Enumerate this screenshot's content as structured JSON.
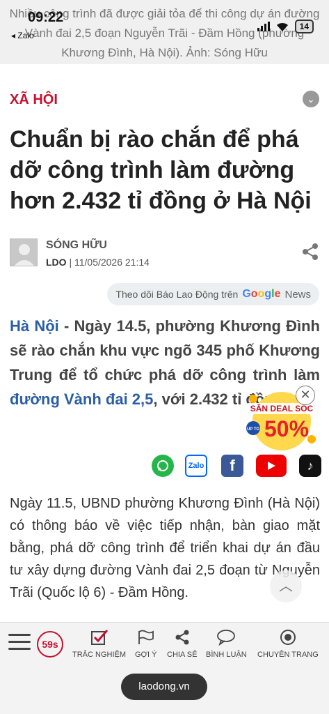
{
  "status_bar": {
    "time": "09:22",
    "back_app": "◂ Zalo",
    "battery": "14"
  },
  "image_caption": "Nhiều công trình đã được giải tỏa để thi công dự án đường Vành đai 2,5 đoạn Nguyễn Trãi - Đầm Hồng (phường Khương Đình, Hà Nội). Ảnh: Sóng Hữu",
  "article": {
    "section": "XÃ HỘI",
    "title": "Chuẩn bị rào chắn để phá dỡ công trình làm đường hơn 2.432 tỉ đồng ở Hà Nội",
    "author": "SÓNG HỮU",
    "source": "LDO",
    "datetime": "| 11/05/2026 21:14",
    "follow": {
      "label": "Theo dõi Báo Lao Động trên",
      "google": "Google",
      "news": "News"
    },
    "lead": {
      "place": "Hà Nội",
      "text1": " - Ngày 14.5, phường Khương Đình sẽ rào chắn khu vực ngõ 345 phố Khương Trung để tổ chức phá dỡ công trình làm ",
      "link": "đường Vành đai 2,5",
      "text2": ", với 2.432 tỉ đồng."
    },
    "body": "Ngày 11.5, UBND phường Khương Đình (Hà Nội) có thông báo về việc tiếp nhận, bàn giao mặt bằng, phá dỡ công trình để triển khai dự án đầu tư xây dựng đường Vành đai 2,5 đoạn từ Nguyễn Trãi (Quốc lộ 6) - Đầm Hồng."
  },
  "promo": {
    "line1": "SĂN DEAL SỐC",
    "upto": "UP TO",
    "percent": "50%"
  },
  "social": {
    "zalo": "Zalo",
    "facebook": "f",
    "tiktok": "♪"
  },
  "bottom_nav": {
    "timer": "59s",
    "items": [
      {
        "label": "TRẮC NGHIỆM",
        "icon": "quiz-check-icon"
      },
      {
        "label": "GỢI Ý",
        "icon": "flag-icon"
      },
      {
        "label": "CHIA SẺ",
        "icon": "share-icon"
      },
      {
        "label": "BÌNH LUẬN",
        "icon": "comment-icon"
      },
      {
        "label": "CHUYÊN TRANG",
        "icon": "target-icon"
      }
    ]
  },
  "url": "laodong.vn",
  "colors": {
    "brand_red": "#c8102e",
    "link_blue": "#2b5ea7"
  }
}
